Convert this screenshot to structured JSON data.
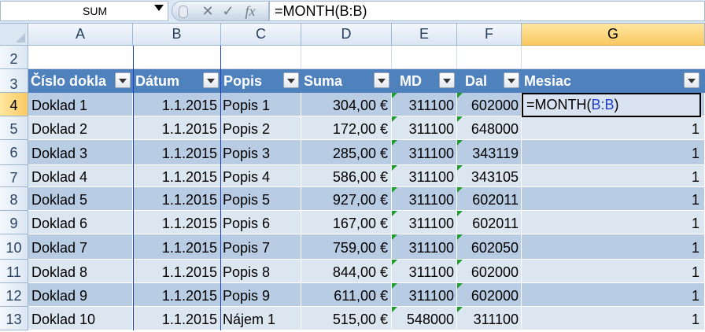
{
  "formula_bar": {
    "name_box": "SUM",
    "cancel_icon": "✕",
    "enter_icon": "✓",
    "fx_label": "fx",
    "formula": "=MONTH(B:B)"
  },
  "columns": [
    "A",
    "B",
    "C",
    "D",
    "E",
    "F",
    "G"
  ],
  "row_numbers": [
    "2",
    "3",
    "4",
    "5",
    "6",
    "7",
    "8",
    "9",
    "10",
    "11",
    "12",
    "13"
  ],
  "table": {
    "headers": [
      "Číslo dokla",
      "Dátum",
      "Popis",
      "Suma",
      "MD",
      "Dal",
      "Mesiac"
    ],
    "rows": [
      [
        "Doklad 1",
        "1.1.2015",
        "Popis 1",
        "304,00 €",
        "311100",
        "602000",
        ""
      ],
      [
        "Doklad 2",
        "1.1.2015",
        "Popis 2",
        "172,00 €",
        "311100",
        "648000",
        "1"
      ],
      [
        "Doklad 3",
        "1.1.2015",
        "Popis 3",
        "285,00 €",
        "311100",
        "343119",
        "1"
      ],
      [
        "Doklad 4",
        "1.1.2015",
        "Popis 4",
        "586,00 €",
        "311100",
        "343105",
        "1"
      ],
      [
        "Doklad 5",
        "1.1.2015",
        "Popis 5",
        "927,00 €",
        "311100",
        "602011",
        "1"
      ],
      [
        "Doklad 6",
        "1.1.2015",
        "Popis 6",
        "167,00 €",
        "311100",
        "602011",
        "1"
      ],
      [
        "Doklad 7",
        "1.1.2015",
        "Popis 7",
        "759,00 €",
        "311100",
        "602050",
        "1"
      ],
      [
        "Doklad 8",
        "1.1.2015",
        "Popis 8",
        "844,00 €",
        "311100",
        "602000",
        "1"
      ],
      [
        "Doklad 9",
        "1.1.2015",
        "Popis 9",
        "611,00 €",
        "311100",
        "602000",
        "1"
      ],
      [
        "Doklad 10",
        "1.1.2015",
        "Nájem 1",
        "515,00 €",
        "548000",
        "311100",
        "1"
      ]
    ]
  },
  "editing_cell": {
    "prefix": "=MONTH(",
    "reference": "B:B",
    "suffix": ")"
  },
  "colors": {
    "header_fill": "#4f81bd",
    "band_dark": "#b8cce4",
    "band_light": "#dce6f1",
    "reference_blue": "#1f3fc8",
    "error_indicator": "#1e9c2c"
  }
}
